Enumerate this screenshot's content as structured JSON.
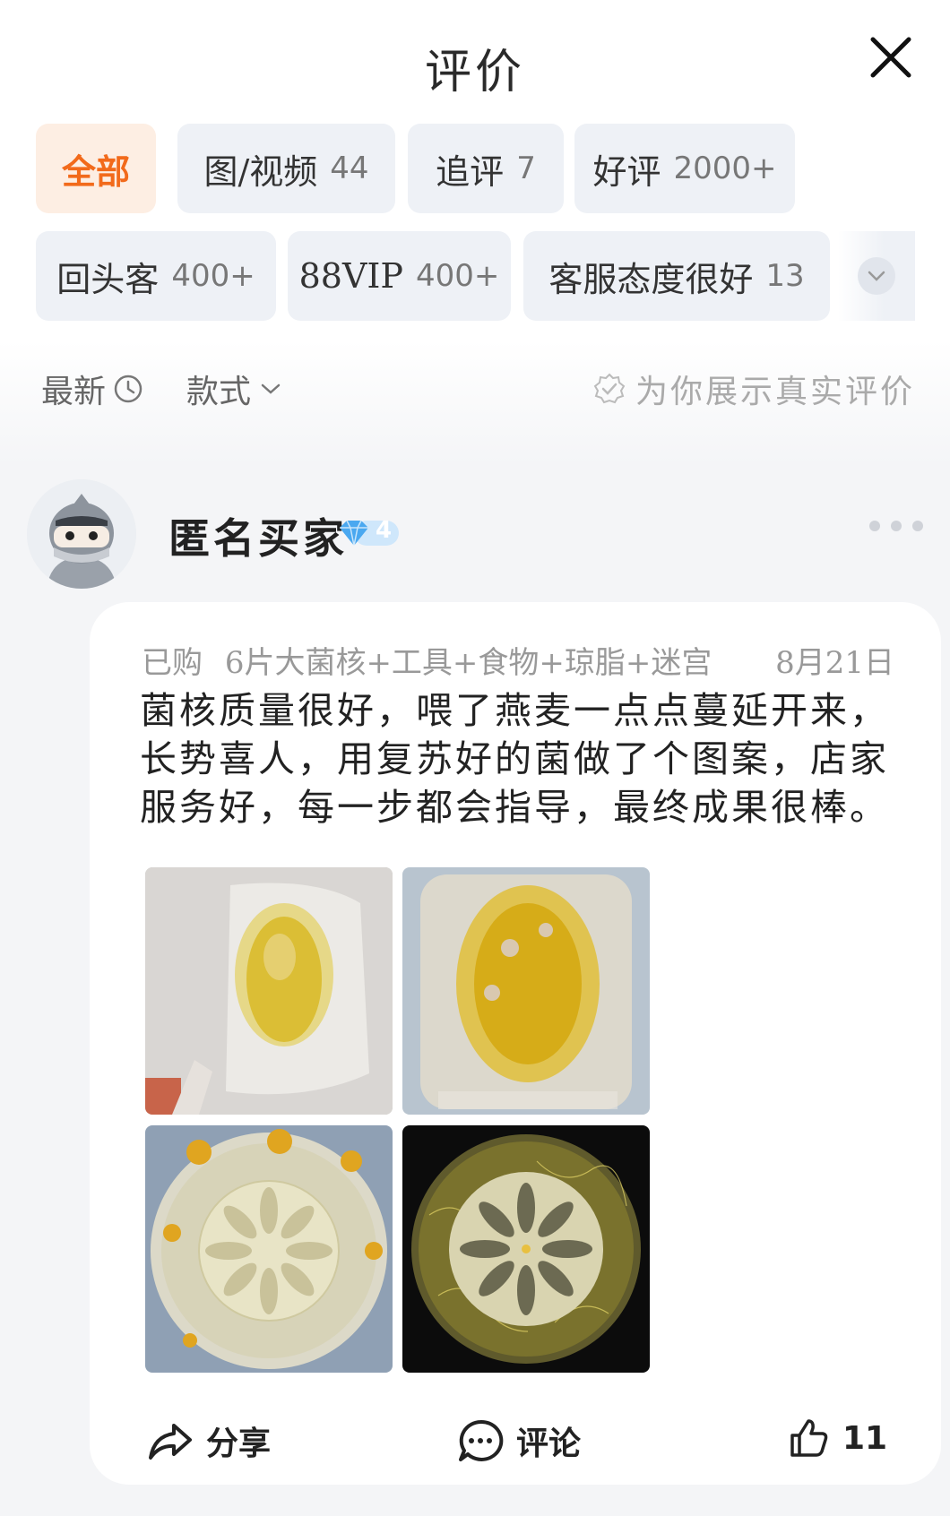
{
  "header": {
    "title": "评价"
  },
  "filters": [
    {
      "label": "全部",
      "count": ""
    },
    {
      "label": "图/视频",
      "count": "44"
    },
    {
      "label": "追评",
      "count": "7"
    },
    {
      "label": "好评",
      "count": "2000+"
    },
    {
      "label": "回头客",
      "count": "400+"
    },
    {
      "label": "88VIP",
      "count": "400+"
    },
    {
      "label": "客服态度很好",
      "count": "13"
    }
  ],
  "sort": {
    "newest": "最新",
    "style": "款式",
    "verified": "为你展示真实评价"
  },
  "review": {
    "user": "匿名买家",
    "level": "4",
    "purchase_label": "已购",
    "sku": "6片大菌核+工具+食物+琼脂+迷宫",
    "date": "8月21日",
    "text": "菌核质量很好，喂了燕麦一点点蔓延开来，长势喜人，用复苏好的菌做了个图案，店家服务好，每一步都会指导，最终成果很棒。",
    "photos": [
      "yellow-culture-on-agar",
      "spreading-culture-on-agar",
      "flower-stencil-dish",
      "flower-pattern-grown"
    ],
    "actions": {
      "share": "分享",
      "comment": "评论",
      "likes": "11"
    }
  },
  "colors": {
    "accent": "#f26a1b",
    "chip_bg": "#eef1f6",
    "diamond": "#4aa8f0"
  }
}
